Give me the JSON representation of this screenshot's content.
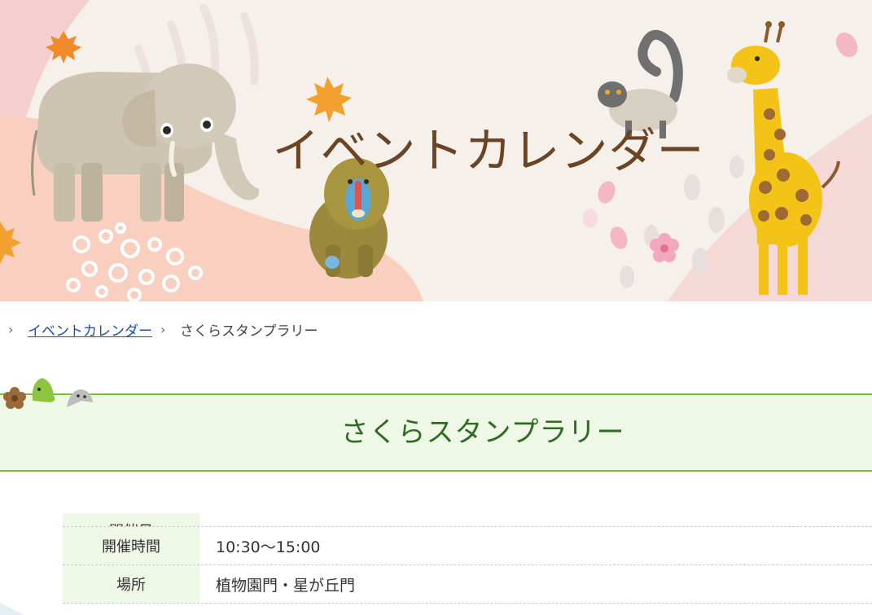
{
  "hero": {
    "title": "イベントカレンダー",
    "animals": [
      "elephant",
      "mandrill",
      "ring-tailed-lemur",
      "giraffe"
    ],
    "decor": [
      "maple-leaf-icon",
      "sakura-flower-icon",
      "sakura-petal-icon"
    ],
    "colors": {
      "background": "#f5f1ea",
      "title": "#6b4425",
      "pink": "#f2c7c8"
    }
  },
  "breadcrumb": {
    "items": [
      {
        "label": "イベントカレンダー",
        "link": true
      },
      {
        "label": "さくらスタンプラリー",
        "link": false
      }
    ]
  },
  "page": {
    "title": "さくらスタンプラリー",
    "colors": {
      "band": "#eff7e6",
      "border": "#7dbb3b",
      "text": "#2f6b22"
    }
  },
  "info": {
    "rows": [
      {
        "label": "開催日",
        "value": ""
      },
      {
        "label": "開催時間",
        "value": "10:30〜15:00"
      },
      {
        "label": "場所",
        "value": "植物園門・星が丘門"
      }
    ]
  }
}
